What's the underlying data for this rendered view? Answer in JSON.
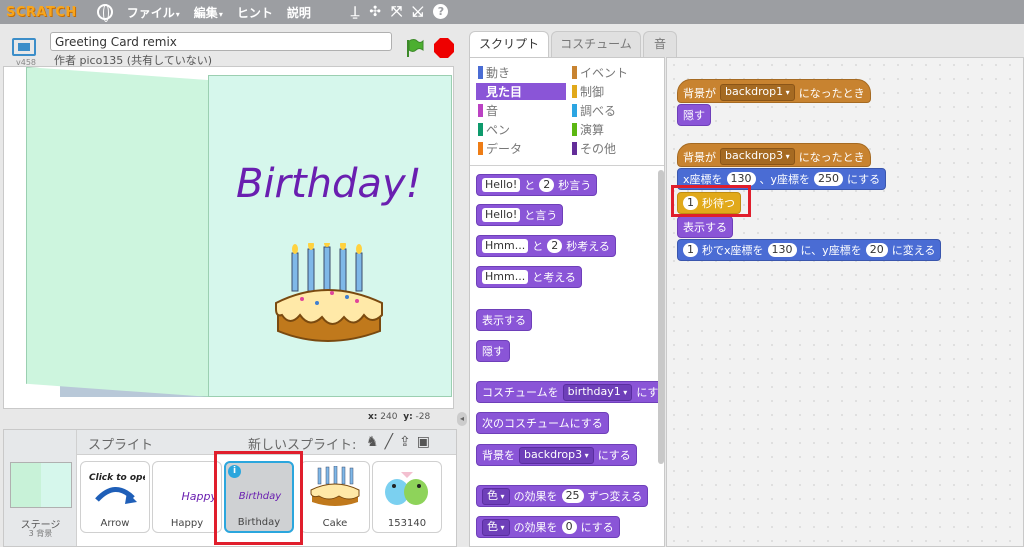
{
  "menubar": {
    "logo": "SCRATCH",
    "items": [
      {
        "label": "ファイル",
        "caret": "▾"
      },
      {
        "label": "編集",
        "caret": "▾"
      },
      {
        "label": "ヒント",
        "caret": ""
      },
      {
        "label": "説明",
        "caret": ""
      }
    ],
    "tools": [
      "copy-icon",
      "delete-icon",
      "grow-icon",
      "shrink-icon",
      "help-icon"
    ]
  },
  "stage_header": {
    "version": "v458",
    "project_title": "Greeting Card remix",
    "author": "作者 pico135 (共有していない)"
  },
  "stage": {
    "text": "Birthday!",
    "coord_x_label": "x:",
    "coord_x": "240",
    "coord_y_label": "y:",
    "coord_y": "-28"
  },
  "sprite_pane": {
    "title": "スプライト",
    "new_sprite": "新しいスプライト:",
    "stage_label": "ステージ",
    "stage_sub": "3 背景",
    "sprites": [
      {
        "name": "Arrow",
        "thumb_text": "Click to open!"
      },
      {
        "name": "Happy",
        "thumb_text": "Happy"
      },
      {
        "name": "Birthday",
        "thumb_text": "Birthday"
      },
      {
        "name": "Cake",
        "thumb_text": ""
      },
      {
        "name": "153140",
        "thumb_text": ""
      }
    ]
  },
  "tabs": [
    "スクリプト",
    "コスチューム",
    "音"
  ],
  "categories": [
    {
      "label": "動き",
      "color": "#4a6cd4"
    },
    {
      "label": "イベント",
      "color": "#c88330"
    },
    {
      "label": "見た目",
      "color": "#8a55d7"
    },
    {
      "label": "制御",
      "color": "#e1a91a"
    },
    {
      "label": "音",
      "color": "#bb42c3"
    },
    {
      "label": "調べる",
      "color": "#2ca5e2"
    },
    {
      "label": "ペン",
      "color": "#0e9a6c"
    },
    {
      "label": "演算",
      "color": "#5cb712"
    },
    {
      "label": "データ",
      "color": "#ee7d16"
    },
    {
      "label": "その他",
      "color": "#632d99"
    }
  ],
  "palette_blocks": {
    "say_secs": {
      "slot": "Hello!",
      "mid": "と",
      "num": "2",
      "end": "秒言う"
    },
    "say": {
      "slot": "Hello!",
      "end": "と言う"
    },
    "think_secs": {
      "slot": "Hmm...",
      "mid": "と",
      "num": "2",
      "end": "秒考える"
    },
    "think": {
      "slot": "Hmm...",
      "end": "と考える"
    },
    "show": "表示する",
    "hide": "隠す",
    "switch_costume": {
      "start": "コスチュームを",
      "drop": "birthday1",
      "end": "にす"
    },
    "next_costume": "次のコスチュームにする",
    "switch_backdrop": {
      "start": "背景を",
      "drop": "backdrop3",
      "end": "にする"
    },
    "change_effect": {
      "drop": "色",
      "mid": "の効果を",
      "num": "25",
      "end": "ずつ変える"
    },
    "set_effect": {
      "drop": "色",
      "mid": "の効果を",
      "num": "0",
      "end": "にする"
    }
  },
  "scripts": {
    "hat1": {
      "start": "背景が",
      "drop": "backdrop1",
      "end": "になったとき"
    },
    "hide": "隠す",
    "hat2": {
      "start": "背景が",
      "drop": "backdrop3",
      "end": "になったとき"
    },
    "goto": {
      "a": "x座標を",
      "x": "130",
      "b": "、y座標を",
      "y": "250",
      "c": "にする"
    },
    "wait": {
      "num": "1",
      "label": "秒待つ"
    },
    "show": "表示する",
    "glide": {
      "num": "1",
      "a": "秒でx座標を",
      "x": "130",
      "b": "に、y座標を",
      "y": "20",
      "c": "に変える"
    }
  }
}
